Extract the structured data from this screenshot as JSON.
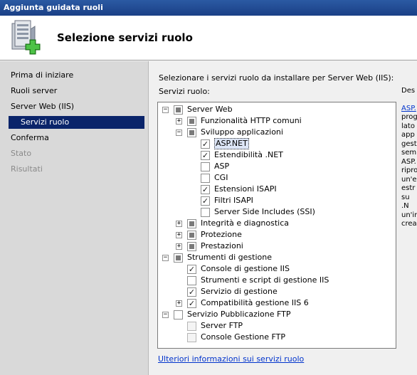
{
  "window": {
    "title": "Aggiunta guidata ruoli"
  },
  "header": {
    "title": "Selezione servizi ruolo",
    "icon": "server-add-icon"
  },
  "sidebar": {
    "items": [
      {
        "label": "Prima di iniziare",
        "state": "normal"
      },
      {
        "label": "Ruoli server",
        "state": "normal"
      },
      {
        "label": "Server Web (IIS)",
        "state": "normal"
      },
      {
        "label": "Servizi ruolo",
        "state": "active"
      },
      {
        "label": "Conferma",
        "state": "normal"
      },
      {
        "label": "Stato",
        "state": "disabled"
      },
      {
        "label": "Risultati",
        "state": "disabled"
      }
    ]
  },
  "main": {
    "instruction": "Selezionare i servizi ruolo da installare per Server Web (IIS):",
    "services_label": "Servizi ruolo:",
    "more_info_link": "Ulteriori informazioni sui servizi ruolo"
  },
  "tree": [
    {
      "label": "Server Web",
      "expander": "-",
      "check": "partial"
    },
    {
      "label": "Funzionalità HTTP comuni",
      "expander": "+",
      "check": "partial"
    },
    {
      "label": "Sviluppo applicazioni",
      "expander": "-",
      "check": "partial"
    },
    {
      "label": "ASP.NET",
      "expander": "",
      "check": "checked",
      "selected": true
    },
    {
      "label": "Estendibilità .NET",
      "expander": "",
      "check": "checked"
    },
    {
      "label": "ASP",
      "expander": "",
      "check": "unchecked"
    },
    {
      "label": "CGI",
      "expander": "",
      "check": "unchecked"
    },
    {
      "label": "Estensioni ISAPI",
      "expander": "",
      "check": "checked"
    },
    {
      "label": "Filtri ISAPI",
      "expander": "",
      "check": "checked"
    },
    {
      "label": "Server Side Includes (SSI)",
      "expander": "",
      "check": "unchecked"
    },
    {
      "label": "Integrità e diagnostica",
      "expander": "+",
      "check": "partial"
    },
    {
      "label": "Protezione",
      "expander": "+",
      "check": "partial"
    },
    {
      "label": "Prestazioni",
      "expander": "+",
      "check": "partial"
    },
    {
      "label": "Strumenti di gestione",
      "expander": "-",
      "check": "partial"
    },
    {
      "label": "Console di gestione IIS",
      "expander": "",
      "check": "checked"
    },
    {
      "label": "Strumenti e script di gestione IIS",
      "expander": "",
      "check": "unchecked"
    },
    {
      "label": "Servizio di gestione",
      "expander": "",
      "check": "checked"
    },
    {
      "label": "Compatibilità gestione IIS 6",
      "expander": "+",
      "check": "checked"
    },
    {
      "label": "Servizio Pubblicazione FTP",
      "expander": "-",
      "check": "unchecked"
    },
    {
      "label": "Server FTP",
      "expander": "",
      "check": "unchecked",
      "disabled": true
    },
    {
      "label": "Console Gestione FTP",
      "expander": "",
      "check": "unchecked",
      "disabled": true
    }
  ],
  "description": {
    "heading": "Des",
    "link": "ASP.",
    "lines": [
      "prog",
      "lato",
      "app",
      "gest",
      "sem",
      "ASP.",
      "ripro",
      "un'e",
      "estr",
      "su .N",
      "un'in",
      "crea"
    ]
  },
  "colors": {
    "titlebar": "#1a3f86",
    "active_nav": "#0a246a",
    "link": "#0033cc",
    "sidebar_bg": "#d9d9d9"
  }
}
